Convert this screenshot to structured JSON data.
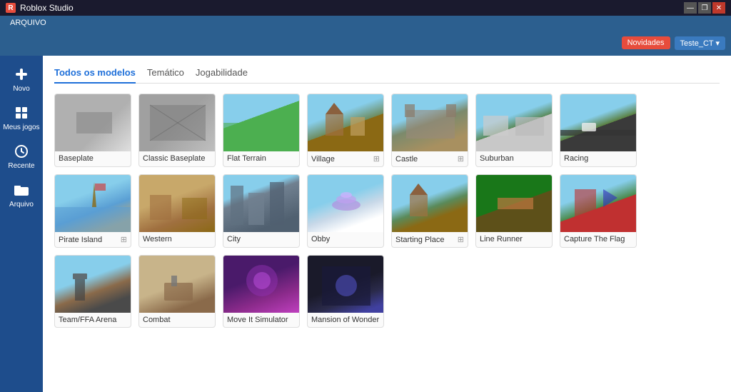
{
  "titlebar": {
    "title": "Roblox Studio",
    "controls": [
      "—",
      "❐",
      "✕"
    ]
  },
  "menubar": {
    "items": [
      "ARQUIVO"
    ]
  },
  "actionbar": {
    "novidades": "Novidades",
    "user": "Teste_CT ▾"
  },
  "sidebar": {
    "items": [
      {
        "id": "novo",
        "label": "Novo",
        "icon": "plus"
      },
      {
        "id": "meusjogos",
        "label": "Meus jogos",
        "icon": "grid"
      },
      {
        "id": "recente",
        "label": "Recente",
        "icon": "clock"
      },
      {
        "id": "arquivo",
        "label": "Arquivo",
        "icon": "folder"
      }
    ]
  },
  "tabs": [
    {
      "id": "todos",
      "label": "Todos os modelos",
      "active": true
    },
    {
      "id": "tematico",
      "label": "Temático",
      "active": false
    },
    {
      "id": "jogabilidade",
      "label": "Jogabilidade",
      "active": false
    }
  ],
  "cards": [
    {
      "id": "baseplate",
      "label": "Baseplate",
      "bookmark": false,
      "thumb": "thumb-baseplate"
    },
    {
      "id": "classic-baseplate",
      "label": "Classic Baseplate",
      "bookmark": false,
      "thumb": "thumb-classic"
    },
    {
      "id": "flat-terrain",
      "label": "Flat Terrain",
      "bookmark": false,
      "thumb": "thumb-flat-terrain"
    },
    {
      "id": "village",
      "label": "Village",
      "bookmark": true,
      "thumb": "thumb-village"
    },
    {
      "id": "castle",
      "label": "Castle",
      "bookmark": true,
      "thumb": "thumb-castle"
    },
    {
      "id": "suburban",
      "label": "Suburban",
      "bookmark": false,
      "thumb": "thumb-suburban"
    },
    {
      "id": "racing",
      "label": "Racing",
      "bookmark": false,
      "thumb": "thumb-racing"
    },
    {
      "id": "pirate-island",
      "label": "Pirate Island",
      "bookmark": true,
      "thumb": "thumb-pirate"
    },
    {
      "id": "western",
      "label": "Western",
      "bookmark": false,
      "thumb": "thumb-western"
    },
    {
      "id": "city",
      "label": "City",
      "bookmark": false,
      "thumb": "thumb-city"
    },
    {
      "id": "obby",
      "label": "Obby",
      "bookmark": false,
      "thumb": "thumb-obby"
    },
    {
      "id": "starting-place",
      "label": "Starting Place",
      "bookmark": true,
      "thumb": "thumb-starting"
    },
    {
      "id": "line-runner",
      "label": "Line Runner",
      "bookmark": false,
      "thumb": "thumb-linerunner"
    },
    {
      "id": "capture-the-flag",
      "label": "Capture The Flag",
      "bookmark": false,
      "thumb": "thumb-ctf"
    },
    {
      "id": "team-ffa",
      "label": "Team/FFA Arena",
      "bookmark": false,
      "thumb": "thumb-teamffa"
    },
    {
      "id": "combat",
      "label": "Combat",
      "bookmark": false,
      "thumb": "thumb-combat"
    },
    {
      "id": "move-it-simulator",
      "label": "Move It Simulator",
      "bookmark": false,
      "thumb": "thumb-moveit"
    },
    {
      "id": "mansion-of-wonder",
      "label": "Mansion of Wonder",
      "bookmark": false,
      "thumb": "thumb-mansion"
    }
  ]
}
